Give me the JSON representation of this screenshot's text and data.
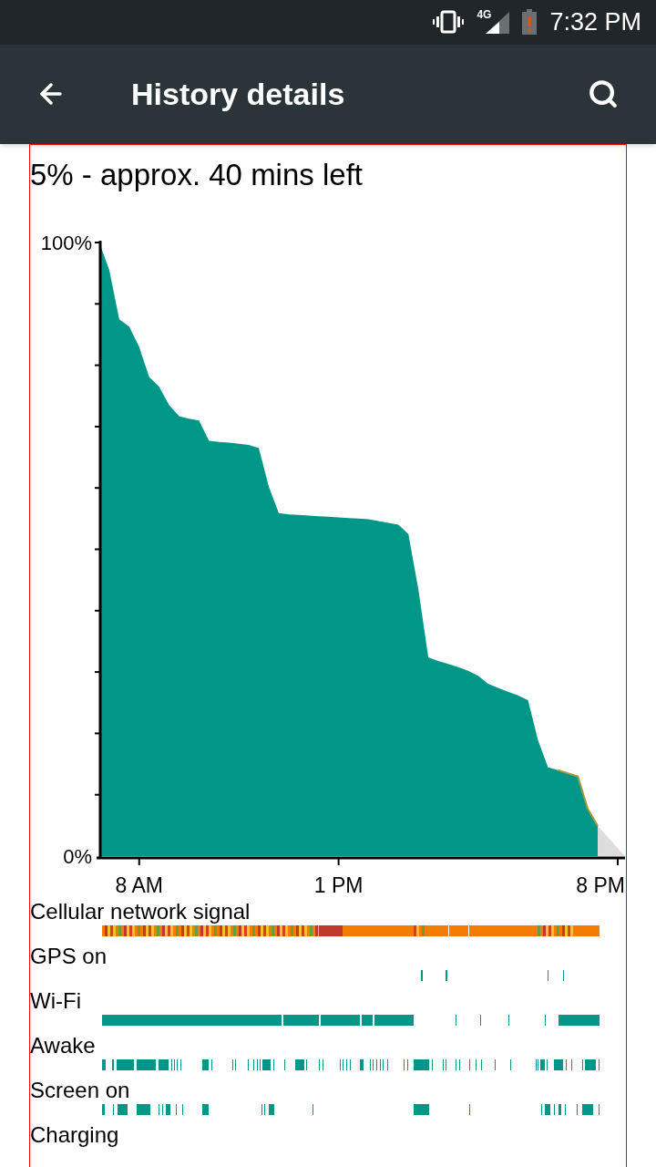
{
  "status_bar": {
    "network": "4G",
    "time": "7:32 PM"
  },
  "app_bar": {
    "title": "History details"
  },
  "summary": "5% - approx. 40 mins left",
  "chart_data": {
    "type": "area",
    "categories": [
      null,
      null,
      null,
      null,
      "8 AM",
      null,
      null,
      null,
      null,
      null,
      null,
      null,
      null,
      null,
      null,
      null,
      null,
      null,
      null,
      null,
      null,
      null,
      null,
      null,
      "1 PM",
      null,
      null,
      null,
      null,
      null,
      null,
      null,
      null,
      null,
      null,
      null,
      null,
      null,
      null,
      null,
      null,
      null,
      null,
      null,
      null,
      null,
      null,
      null,
      null,
      null,
      null,
      null,
      "8 PM"
    ],
    "series": [
      {
        "color": "#009688",
        "values": [
          100,
          95.5,
          87.5,
          86.3,
          83,
          78.1,
          76.5,
          73.5,
          71.7,
          71.3,
          71,
          67.7,
          67.5,
          67.4,
          67.2,
          67.0,
          66.5,
          60.2,
          55.9,
          55.7,
          55.6,
          55.5,
          55.4,
          55.3,
          55.2,
          55.1,
          55.0,
          54.9,
          54.6,
          54.3,
          54,
          52.5,
          43.5,
          32.4,
          31.8,
          31.3,
          30.8,
          30.2,
          29.4,
          28.1,
          27.4,
          26.8,
          26.2,
          25.4,
          18.9,
          14.5,
          14.0,
          13.5,
          13.0,
          7.7,
          4.9,
          null,
          null
        ]
      }
    ],
    "ylim": [
      0,
      100
    ],
    "yticks": [
      {
        "value": 0,
        "label": "0%"
      },
      {
        "value": 100,
        "label": "100%"
      }
    ]
  },
  "tracks": [
    {
      "label": "Cellular network signal",
      "kind": "signal"
    },
    {
      "label": "GPS on",
      "kind": "gps"
    },
    {
      "label": "Wi-Fi",
      "kind": "wifi"
    },
    {
      "label": "Awake",
      "kind": "awake"
    },
    {
      "label": "Screen on",
      "kind": "screen"
    },
    {
      "label": "Charging",
      "kind": "charging"
    }
  ]
}
